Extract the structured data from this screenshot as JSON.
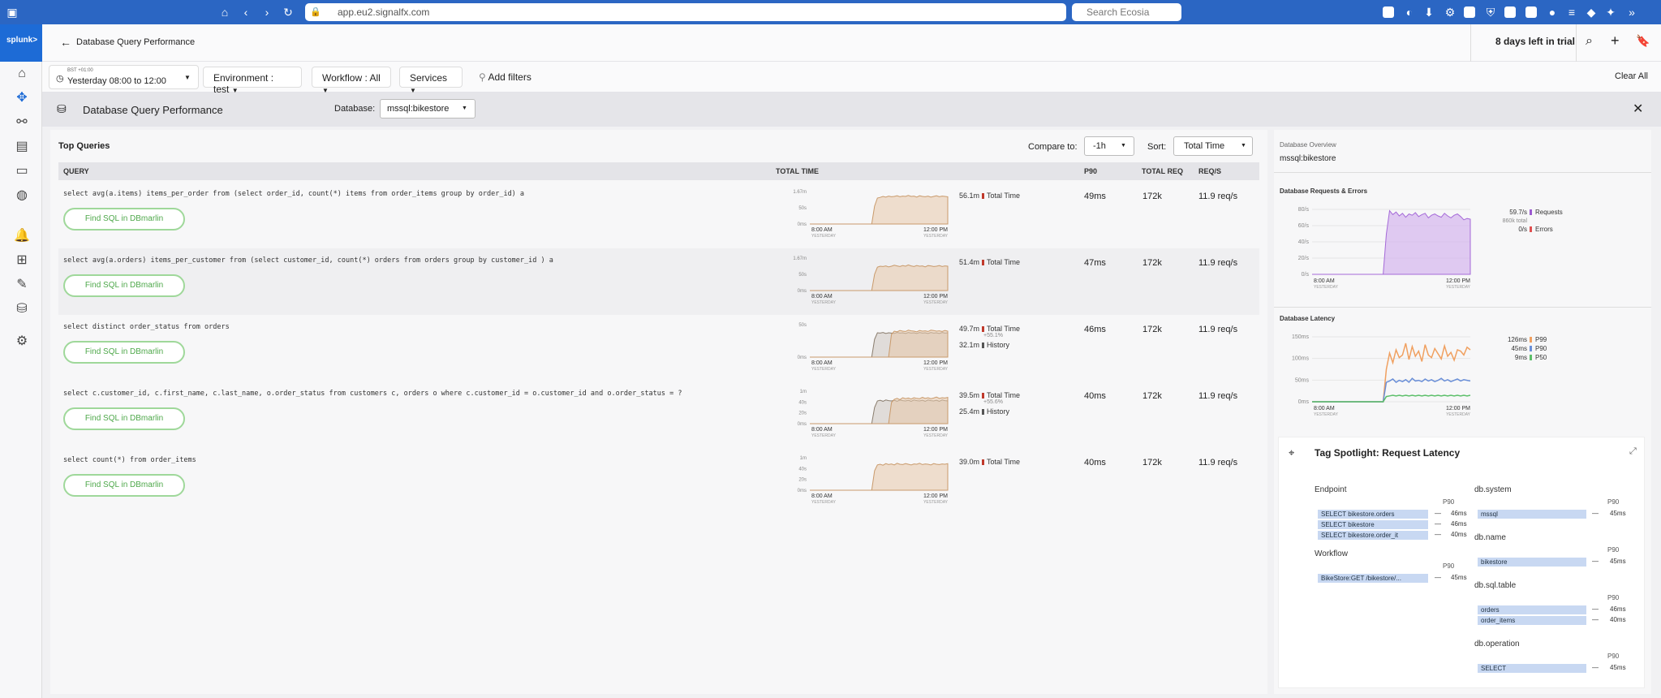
{
  "browser": {
    "url": "app.eu2.signalfx.com",
    "search_placeholder": "Search Ecosia"
  },
  "app": {
    "logo": "splunk>",
    "page_title": "Database Query Performance",
    "trial_text": "8 days left in trial"
  },
  "filters": {
    "timezone": "BST +01:00",
    "time_range": "Yesterday 08:00 to 12:00",
    "environment": "Environment : test",
    "workflow": "Workflow : All",
    "services": "Services",
    "add_filters": "Add filters",
    "clear_all": "Clear All"
  },
  "dashboard": {
    "title": "Database Query Performance",
    "database_label": "Database:",
    "database_value": "mssql:bikestore"
  },
  "top_queries": {
    "title": "Top Queries",
    "compare_label": "Compare to:",
    "compare_value": "-1h",
    "sort_label": "Sort:",
    "sort_value": "Total Time",
    "headers": {
      "query": "QUERY",
      "total_time": "TOTAL TIME",
      "p90": "P90",
      "total_req": "TOTAL REQ",
      "req_s": "REQ/S"
    },
    "find_label": "Find SQL in DBmarlin",
    "axis_start": "8:00 AM",
    "axis_end": "12:00 PM",
    "axis_sub": "YESTERDAY",
    "rows": [
      {
        "sql": "select avg(a.items) items_per_order from (select order_id, count(*) items from order_items group by order_id) a",
        "y_ticks": [
          "1.67m",
          "50s",
          "0ms"
        ],
        "total": "56.1m",
        "total_label": "Total Time",
        "change": "",
        "history": "",
        "history_label": "",
        "p90": "49ms",
        "total_req": "172k",
        "req_s": "11.9 req/s",
        "series": [
          0,
          0,
          0,
          0,
          0,
          0,
          0,
          0,
          0,
          0,
          0,
          0,
          0,
          0,
          0,
          0,
          0,
          0,
          0,
          0,
          0,
          0,
          0,
          0.55,
          0.8,
          0.82,
          0.85,
          0.83,
          0.86,
          0.84,
          0.85,
          0.87,
          0.84,
          0.86,
          0.85,
          0.88,
          0.85,
          0.86,
          0.83,
          0.87,
          0.85,
          0.84,
          0.86,
          0.83,
          0.85,
          0.87,
          0.84,
          0.86,
          0.85,
          0.84
        ],
        "history_series": []
      },
      {
        "sql": "select avg(a.orders) items_per_customer from (select customer_id, count(*) orders from orders group by customer_id ) a",
        "y_ticks": [
          "1.67m",
          "50s",
          "0ms"
        ],
        "total": "51.4m",
        "total_label": "Total Time",
        "change": "",
        "history": "",
        "history_label": "",
        "p90": "47ms",
        "total_req": "172k",
        "req_s": "11.9 req/s",
        "series": [
          0,
          0,
          0,
          0,
          0,
          0,
          0,
          0,
          0,
          0,
          0,
          0,
          0,
          0,
          0,
          0,
          0,
          0,
          0,
          0,
          0,
          0,
          0,
          0.5,
          0.72,
          0.75,
          0.74,
          0.76,
          0.73,
          0.75,
          0.78,
          0.76,
          0.74,
          0.77,
          0.75,
          0.79,
          0.76,
          0.74,
          0.77,
          0.75,
          0.76,
          0.73,
          0.77,
          0.76,
          0.74,
          0.75,
          0.77,
          0.74,
          0.76,
          0.75
        ],
        "history_series": []
      },
      {
        "sql": "select distinct order_status from orders",
        "y_ticks": [
          "50s",
          "0ms"
        ],
        "total": "49.7m",
        "total_label": "Total Time",
        "change": "+55.1%",
        "history": "32.1m",
        "history_label": "History",
        "p90": "46ms",
        "total_req": "172k",
        "req_s": "11.9 req/s",
        "series": [
          0,
          0,
          0,
          0,
          0,
          0,
          0,
          0,
          0,
          0,
          0,
          0,
          0,
          0,
          0,
          0,
          0,
          0,
          0,
          0,
          0,
          0,
          0,
          0,
          0,
          0,
          0,
          0,
          0,
          0.7,
          0.8,
          0.78,
          0.82,
          0.8,
          0.79,
          0.83,
          0.81,
          0.8,
          0.78,
          0.82,
          0.8,
          0.81,
          0.79,
          0.83,
          0.82,
          0.8,
          0.81,
          0.79,
          0.82,
          0.8
        ],
        "history_series": [
          0,
          0,
          0,
          0,
          0,
          0,
          0,
          0,
          0,
          0,
          0,
          0,
          0,
          0,
          0,
          0,
          0,
          0,
          0,
          0,
          0,
          0,
          0,
          0.55,
          0.75,
          0.74,
          0.76,
          0.73,
          0.75,
          0.74,
          0.73,
          0.76,
          0.74,
          0.75,
          0.73,
          0.76,
          0.74,
          0.75,
          0.73,
          0.76,
          0.74,
          0.75,
          0.73,
          0.76,
          0.74,
          0.75,
          0.73,
          0.76,
          0.74,
          0.75
        ]
      },
      {
        "sql": "select c.customer_id, c.first_name, c.last_name, o.order_status from customers c, orders o where c.customer_id = o.customer_id and o.order_status = ?",
        "y_ticks": [
          "1m",
          "40s",
          "20s",
          "0ms"
        ],
        "total": "39.5m",
        "total_label": "Total Time",
        "change": "+55.6%",
        "history": "25.4m",
        "history_label": "History",
        "p90": "40ms",
        "total_req": "172k",
        "req_s": "11.9 req/s",
        "series": [
          0,
          0,
          0,
          0,
          0,
          0,
          0,
          0,
          0,
          0,
          0,
          0,
          0,
          0,
          0,
          0,
          0,
          0,
          0,
          0,
          0,
          0,
          0,
          0,
          0,
          0,
          0,
          0,
          0,
          0.65,
          0.75,
          0.78,
          0.74,
          0.8,
          0.77,
          0.79,
          0.76,
          0.8,
          0.78,
          0.77,
          0.81,
          0.78,
          0.8,
          0.77,
          0.79,
          0.82,
          0.78,
          0.8,
          0.79,
          0.81
        ],
        "history_series": [
          0,
          0,
          0,
          0,
          0,
          0,
          0,
          0,
          0,
          0,
          0,
          0,
          0,
          0,
          0,
          0,
          0,
          0,
          0,
          0,
          0,
          0,
          0,
          0.5,
          0.7,
          0.72,
          0.69,
          0.73,
          0.71,
          0.7,
          0.72,
          0.69,
          0.73,
          0.71,
          0.7,
          0.72,
          0.69,
          0.73,
          0.71,
          0.7,
          0.72,
          0.69,
          0.73,
          0.71,
          0.7,
          0.72,
          0.69,
          0.73,
          0.71,
          0.7
        ]
      },
      {
        "sql": "select count(*) from order_items",
        "y_ticks": [
          "1m",
          "40s",
          "20s",
          "0ms"
        ],
        "total": "39.0m",
        "total_label": "Total Time",
        "change": "",
        "history": "",
        "history_label": "",
        "p90": "40ms",
        "total_req": "172k",
        "req_s": "11.9 req/s",
        "series": [
          0,
          0,
          0,
          0,
          0,
          0,
          0,
          0,
          0,
          0,
          0,
          0,
          0,
          0,
          0,
          0,
          0,
          0,
          0,
          0,
          0,
          0,
          0,
          0.6,
          0.78,
          0.8,
          0.77,
          0.82,
          0.79,
          0.81,
          0.78,
          0.83,
          0.8,
          0.79,
          0.82,
          0.8,
          0.78,
          0.81,
          0.8,
          0.83,
          0.79,
          0.81,
          0.8,
          0.78,
          0.82,
          0.8,
          0.79,
          0.81,
          0.8,
          0.82
        ],
        "history_series": []
      }
    ]
  },
  "overview": {
    "label": "Database Overview",
    "value": "mssql:bikestore"
  },
  "requests_chart": {
    "title": "Database Requests & Errors",
    "y_ticks": [
      "80/s",
      "60/s",
      "40/s",
      "20/s",
      "0/s"
    ],
    "legend": [
      {
        "value": "59.7/s",
        "label": "Requests",
        "sub": "860k total",
        "color": "#9b59d0"
      },
      {
        "value": "0/s",
        "label": "Errors",
        "sub": "",
        "color": "#e05050"
      }
    ],
    "series": [
      0,
      0,
      0,
      0,
      0,
      0,
      0,
      0,
      0,
      0,
      0,
      0,
      0,
      0,
      0,
      0,
      0,
      0,
      0,
      0,
      0,
      0,
      0,
      0.62,
      0.98,
      0.92,
      0.96,
      0.9,
      0.94,
      0.88,
      0.93,
      0.91,
      0.95,
      0.89,
      0.92,
      0.94,
      0.87,
      0.91,
      0.93,
      0.9,
      0.88,
      0.94,
      0.9,
      0.87,
      0.91,
      0.93,
      0.89,
      0.84,
      0.86,
      0.85
    ]
  },
  "latency_chart": {
    "title": "Database Latency",
    "y_ticks": [
      "150ms",
      "100ms",
      "50ms",
      "0ms"
    ],
    "legend": [
      {
        "value": "126ms",
        "label": "P99",
        "color": "#f0a060"
      },
      {
        "value": "45ms",
        "label": "P90",
        "color": "#6a8fd8"
      },
      {
        "value": "9ms",
        "label": "P50",
        "color": "#5cbf6a"
      }
    ],
    "p99": [
      0,
      0,
      0,
      0,
      0,
      0,
      0,
      0,
      0,
      0,
      0,
      0,
      0,
      0,
      0,
      0,
      0,
      0,
      0,
      0,
      0,
      0,
      0,
      0.5,
      0.75,
      0.6,
      0.8,
      0.68,
      0.72,
      0.9,
      0.65,
      0.85,
      0.7,
      0.78,
      0.62,
      0.88,
      0.72,
      0.68,
      0.82,
      0.74,
      0.66,
      0.86,
      0.7,
      0.76,
      0.64,
      0.8,
      0.78,
      0.72,
      0.84,
      0.8
    ],
    "p90": [
      0,
      0,
      0,
      0,
      0,
      0,
      0,
      0,
      0,
      0,
      0,
      0,
      0,
      0,
      0,
      0,
      0,
      0,
      0,
      0,
      0,
      0,
      0,
      0.3,
      0.32,
      0.35,
      0.3,
      0.33,
      0.31,
      0.34,
      0.3,
      0.36,
      0.32,
      0.33,
      0.31,
      0.35,
      0.32,
      0.34,
      0.31,
      0.33,
      0.36,
      0.32,
      0.34,
      0.31,
      0.33,
      0.35,
      0.32,
      0.34,
      0.33,
      0.32
    ],
    "p50": [
      0,
      0,
      0,
      0,
      0,
      0,
      0,
      0,
      0,
      0,
      0,
      0,
      0,
      0,
      0,
      0,
      0,
      0,
      0,
      0,
      0,
      0,
      0,
      0.08,
      0.09,
      0.1,
      0.09,
      0.1,
      0.09,
      0.1,
      0.09,
      0.1,
      0.09,
      0.1,
      0.09,
      0.1,
      0.09,
      0.1,
      0.09,
      0.1,
      0.09,
      0.1,
      0.09,
      0.1,
      0.09,
      0.1,
      0.09,
      0.1,
      0.09,
      0.1
    ]
  },
  "chart_axis": {
    "start": "8:00 AM",
    "end": "12:00 PM",
    "sub": "YESTERDAY"
  },
  "spotlight": {
    "title": "Tag Spotlight: Request Latency",
    "p90_label": "P90",
    "left_groups": [
      {
        "name": "Endpoint",
        "items": [
          {
            "label": "SELECT bikestore.orders",
            "value": "46ms"
          },
          {
            "label": "SELECT bikestore",
            "value": "46ms"
          },
          {
            "label": "SELECT bikestore.order_it",
            "value": "40ms"
          }
        ]
      },
      {
        "name": "Workflow",
        "items": [
          {
            "label": "BikeStore:GET /bikestore/...",
            "value": "45ms"
          }
        ]
      }
    ],
    "right_groups": [
      {
        "name": "db.system",
        "items": [
          {
            "label": "mssql",
            "value": "45ms"
          }
        ]
      },
      {
        "name": "db.name",
        "items": [
          {
            "label": "bikestore",
            "value": "45ms"
          }
        ]
      },
      {
        "name": "db.sql.table",
        "items": [
          {
            "label": "orders",
            "value": "46ms"
          },
          {
            "label": "order_items",
            "value": "40ms"
          }
        ]
      },
      {
        "name": "db.operation",
        "items": [
          {
            "label": "SELECT",
            "value": "45ms"
          }
        ]
      }
    ]
  },
  "colors": {
    "accent": "#2b66c3",
    "brand": "#1d6bd6",
    "success": "#4ea84a"
  }
}
